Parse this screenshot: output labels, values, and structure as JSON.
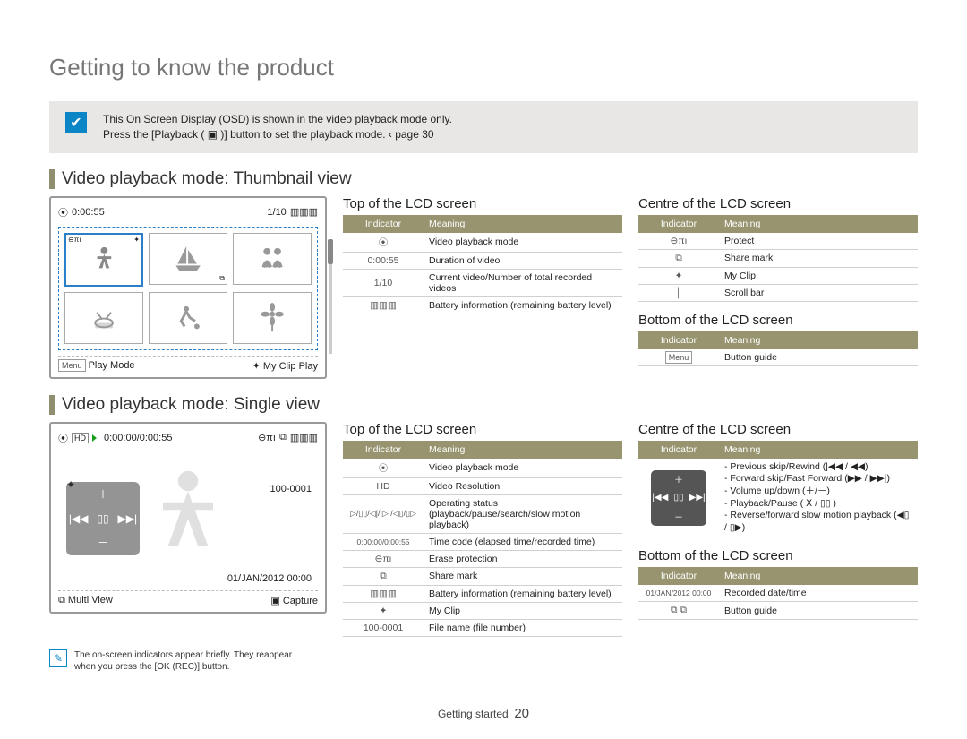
{
  "page_title": "Getting to know the product",
  "note": {
    "line1": "This On Screen Display (OSD) is shown in the video playback mode only.",
    "line2_a": "Press the [Playback (",
    "line2_b": ")] button to set the playback mode. ‹ page 30"
  },
  "section_thumb": "Video playback mode: Thumbnail view",
  "section_single": "Video playback mode: Single view",
  "lcd_thumb": {
    "duration": "0:00:55",
    "count": "1/10",
    "foot_left_icon": "Menu",
    "foot_left": "Play Mode",
    "foot_right": "My Clip Play"
  },
  "lcd_single": {
    "time": "0:00:00/0:00:55",
    "file": "100-0001",
    "datetime": "01/JAN/2012 00:00",
    "foot_left": "Multi View",
    "foot_right": "Capture"
  },
  "headers": {
    "indicator": "Indicator",
    "meaning": "Meaning"
  },
  "sub_top": "Top of the LCD screen",
  "sub_centre": "Centre of the LCD screen",
  "sub_bottom": "Bottom of the LCD screen",
  "thumb_top_table": [
    {
      "ind": "⦿",
      "mean": "Video playback mode"
    },
    {
      "ind": "0:00:55",
      "mean": "Duration of video"
    },
    {
      "ind": "1/10",
      "mean": "Current video/Number of total recorded videos"
    },
    {
      "ind": "▥▥▥",
      "mean": "Battery information (remaining battery level)"
    }
  ],
  "thumb_centre_table": [
    {
      "ind": "⊖πı",
      "mean": "Protect"
    },
    {
      "ind": "⧉",
      "mean": "Share mark"
    },
    {
      "ind": "✦",
      "mean": "My Clip"
    },
    {
      "ind": "│",
      "mean": "Scroll bar"
    }
  ],
  "thumb_bottom_table": [
    {
      "ind": "Menu",
      "mean": "Button guide"
    }
  ],
  "single_top_table": [
    {
      "ind": "⦿",
      "mean": "Video playback mode"
    },
    {
      "ind": "HD",
      "mean": "Video Resolution"
    },
    {
      "ind": "▷/▯▯/◁|/|▷ /◁▯/▯▷",
      "mean": "Operating status (playback/pause/search/slow motion playback)"
    },
    {
      "ind": "0:00:00/0:00:55",
      "mean": "Time code (elapsed time/recorded time)"
    },
    {
      "ind": "⊖πı",
      "mean": "Erase protection"
    },
    {
      "ind": "⧉",
      "mean": "Share mark"
    },
    {
      "ind": "▥▥▥",
      "mean": "Battery information (remaining battery level)"
    },
    {
      "ind": "✦",
      "mean": "My Clip"
    },
    {
      "ind": "100-0001",
      "mean": "File name (file number)"
    }
  ],
  "single_centre_table_mean": "- Previous skip/Rewind (|◀◀ / ◀◀)\n- Forward skip/Fast Forward (▶▶ / ▶▶|)\n- Volume up/down (＋/－)\n- Playback/Pause ( Ⅹ / ▯▯ )\n- Reverse/forward slow motion playback (◀▯ / ▯▶)",
  "single_bottom_table": [
    {
      "ind": "01/JAN/2012 00:00",
      "mean": "Recorded date/time"
    },
    {
      "ind": "⧉  ⧉",
      "mean": "Button guide"
    }
  ],
  "tiny_note": "The on-screen indicators appear briefly. They reappear when you press the [OK (REC)] button.",
  "footer_label": "Getting started",
  "footer_page": "20"
}
